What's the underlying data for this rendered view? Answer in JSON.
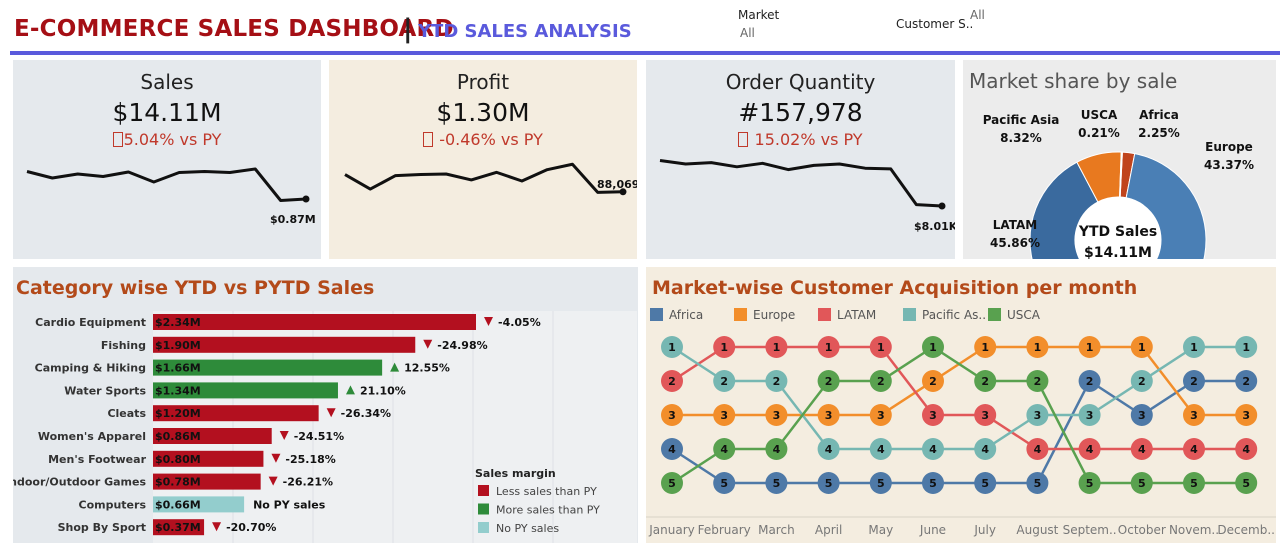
{
  "header": {
    "title": "E-COMMERCE SALES DASHBOARD",
    "separator": "|",
    "subtitle": "YTD SALES ANALYSIS"
  },
  "filters": {
    "market_label": "Market",
    "market_value": "All",
    "customer_label": "Customer S..",
    "customer_value": "All"
  },
  "kpis": [
    {
      "title": "Sales",
      "value": "$14.11M",
      "delta": "5.04% vs PY",
      "last_label": "$0.87M",
      "trend": [
        0.77,
        0.64,
        0.72,
        0.67,
        0.76,
        0.56,
        0.75,
        0.77,
        0.75,
        0.82,
        0.19,
        0.22
      ]
    },
    {
      "title": "Profit",
      "value": "$1.30M",
      "delta": " -0.46% vs PY",
      "last_label": "88,069",
      "trend": [
        0.62,
        0.35,
        0.6,
        0.62,
        0.63,
        0.52,
        0.66,
        0.5,
        0.71,
        0.81,
        0.29,
        0.3
      ]
    },
    {
      "title": "Order Quantity",
      "value": "#157,978",
      "delta": " 15.02% vs PY",
      "last_label": "$8.01K",
      "trend": [
        0.85,
        0.8,
        0.82,
        0.76,
        0.81,
        0.72,
        0.78,
        0.8,
        0.74,
        0.73,
        0.22,
        0.2
      ]
    }
  ],
  "market_share": {
    "title": "Market share by sale",
    "center_label": "YTD Sales",
    "center_value": "$14.11M",
    "slices": [
      {
        "name": "Europe",
        "pct": "43.37%",
        "value": 43.37,
        "color": "#4a7fb5"
      },
      {
        "name": "LATAM",
        "pct": "45.86%",
        "value": 45.86,
        "color": "#3a6a9e"
      },
      {
        "name": "Pacific Asia",
        "pct": "8.32%",
        "value": 8.32,
        "color": "#e8791f"
      },
      {
        "name": "USCA",
        "pct": "0.21%",
        "value": 0.21,
        "color": "#f3f3f3"
      },
      {
        "name": "Africa",
        "pct": "2.25%",
        "value": 2.25,
        "color": "#c0441c"
      }
    ]
  },
  "category": {
    "title": "Category wise YTD vs PYTD Sales",
    "max": 2.34,
    "colors": {
      "less": "#b3101f",
      "more": "#2e8b3a",
      "nopy": "#93cdcd"
    },
    "rows": [
      {
        "name": "Cardio Equipment",
        "value": 2.34,
        "label": "$2.34M",
        "status": "less",
        "change": "-4.05%"
      },
      {
        "name": "Fishing",
        "value": 1.9,
        "label": "$1.90M",
        "status": "less",
        "change": "-24.98%"
      },
      {
        "name": "Camping & Hiking",
        "value": 1.66,
        "label": "$1.66M",
        "status": "more",
        "change": "12.55%"
      },
      {
        "name": "Water Sports",
        "value": 1.34,
        "label": "$1.34M",
        "status": "more",
        "change": "21.10%"
      },
      {
        "name": "Cleats",
        "value": 1.2,
        "label": "$1.20M",
        "status": "less",
        "change": "-26.34%"
      },
      {
        "name": "Women's Apparel",
        "value": 0.86,
        "label": "$0.86M",
        "status": "less",
        "change": "-24.51%"
      },
      {
        "name": "Men's Footwear",
        "value": 0.8,
        "label": "$0.80M",
        "status": "less",
        "change": "-25.18%"
      },
      {
        "name": "Indoor/Outdoor Games",
        "value": 0.78,
        "label": "$0.78M",
        "status": "less",
        "change": "-26.21%"
      },
      {
        "name": "Computers",
        "value": 0.66,
        "label": "$0.66M",
        "status": "nopy",
        "change": "No PY sales"
      },
      {
        "name": "Shop By Sport",
        "value": 0.37,
        "label": "$0.37M",
        "status": "less",
        "change": "-20.70%"
      }
    ],
    "legend_title": "Sales margin",
    "legend": [
      {
        "label": "Less sales than PY",
        "color": "#b3101f"
      },
      {
        "label": "More sales than PY",
        "color": "#2e8b3a"
      },
      {
        "label": "No PY sales",
        "color": "#93cdcd"
      }
    ]
  },
  "acquisition": {
    "title": "Market-wise Customer Acquisition per month",
    "months": [
      "January",
      "February",
      "March",
      "April",
      "May",
      "June",
      "July",
      "August",
      "Septem..",
      "October",
      "Novem..",
      "Decemb.."
    ],
    "markets": [
      {
        "name": "Africa",
        "color": "#4e79a7",
        "ranks": [
          4,
          5,
          5,
          5,
          5,
          5,
          5,
          5,
          2,
          3,
          2,
          2
        ]
      },
      {
        "name": "Europe",
        "color": "#f28e2b",
        "ranks": [
          3,
          3,
          3,
          3,
          3,
          2,
          1,
          1,
          1,
          1,
          3,
          3
        ]
      },
      {
        "name": "LATAM",
        "color": "#e15759",
        "ranks": [
          2,
          1,
          1,
          1,
          1,
          3,
          3,
          4,
          4,
          4,
          4,
          4
        ]
      },
      {
        "name": "Pacific As..",
        "color": "#76b7b2",
        "ranks": [
          1,
          2,
          2,
          4,
          4,
          4,
          4,
          3,
          3,
          2,
          1,
          1
        ]
      },
      {
        "name": "USCA",
        "color": "#59a14f",
        "ranks": [
          5,
          4,
          4,
          2,
          2,
          1,
          2,
          2,
          5,
          5,
          5,
          5
        ]
      }
    ]
  }
}
